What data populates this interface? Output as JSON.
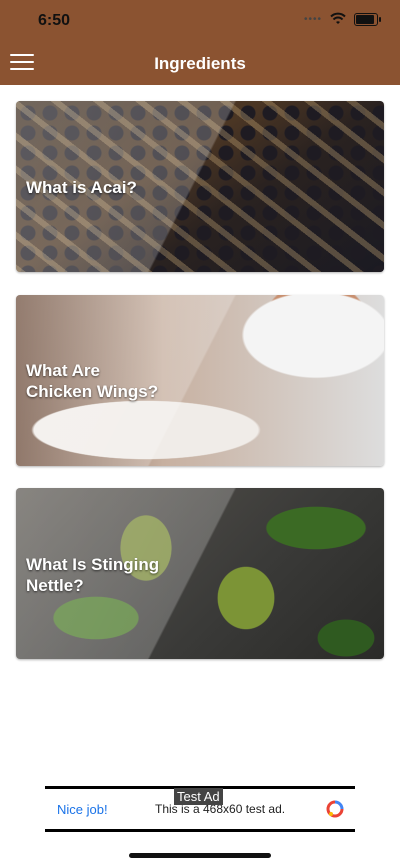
{
  "status_bar": {
    "time": "6:50"
  },
  "header": {
    "title": "Ingredients",
    "menu_icon": "hamburger-menu-icon"
  },
  "cards": [
    {
      "title": "What is Acai?"
    },
    {
      "title": "What Are\nChicken Wings?"
    },
    {
      "title": "What Is Stinging\nNettle?"
    }
  ],
  "ad": {
    "badge": "Test Ad",
    "cta": "Nice job!",
    "text": "This is a 468x60 test ad."
  },
  "colors": {
    "header": "#8b5331"
  }
}
